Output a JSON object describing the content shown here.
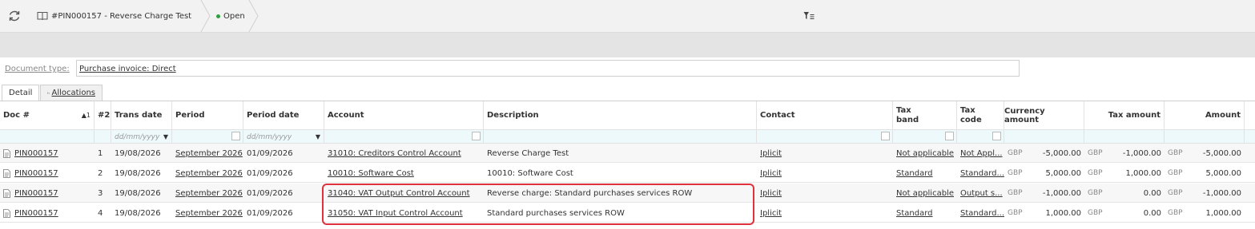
{
  "toolbar": {
    "refresh_icon": "refresh-icon",
    "document_title": "#PIN000157 - Reverse Charge Test",
    "status": "Open",
    "status_color": "#2e9e3e",
    "filter_icon": "filter-icon"
  },
  "document_type": {
    "label": "Document type:",
    "value": "Purchase invoice: Direct"
  },
  "tabs": [
    {
      "label": "Detail"
    },
    {
      "label": "Allocations"
    }
  ],
  "columns": {
    "doc": "Doc #",
    "doc_sort": "▲1",
    "num2": "#2",
    "trans_date": "Trans date",
    "period": "Period",
    "period_date": "Period date",
    "account": "Account",
    "description": "Description",
    "contact": "Contact",
    "tax_band_1": "Tax",
    "tax_band_2": "band",
    "tax_code_1": "Tax",
    "tax_code_2": "code",
    "currency_amount": "Currency amount",
    "tax_amount": "Tax amount",
    "amount": "Amount"
  },
  "filters": {
    "trans_date_placeholder": "dd/mm/yyyy",
    "period_date_placeholder": "dd/mm/yyyy"
  },
  "rows": [
    {
      "doc": "PIN000157",
      "num": "1",
      "trans_date": "19/08/2026",
      "period": "September 2026",
      "period_date": "01/09/2026",
      "account": "31010: Creditors Control Account",
      "description": "Reverse Charge Test",
      "contact": "Iplicit",
      "tax_band": "Not applicable",
      "tax_code": "Not Appl...",
      "cur1": "GBP",
      "currency_amount": "-5,000.00",
      "cur2": "GBP",
      "tax_amount": "-1,000.00",
      "cur3": "GBP",
      "amount": "-5,000.00"
    },
    {
      "doc": "PIN000157",
      "num": "2",
      "trans_date": "19/08/2026",
      "period": "September 2026",
      "period_date": "01/09/2026",
      "account": "10010: Software Cost",
      "description": "10010: Software Cost",
      "contact": "Iplicit",
      "tax_band": "Standard",
      "tax_code": "Standard...",
      "cur1": "GBP",
      "currency_amount": "5,000.00",
      "cur2": "GBP",
      "tax_amount": "1,000.00",
      "cur3": "GBP",
      "amount": "5,000.00"
    },
    {
      "doc": "PIN000157",
      "num": "3",
      "trans_date": "19/08/2026",
      "period": "September 2026",
      "period_date": "01/09/2026",
      "account": "31040: VAT Output Control Account",
      "description": "Reverse charge: Standard purchases services ROW",
      "contact": "Iplicit",
      "tax_band": "Not applicable",
      "tax_code": "Output s...",
      "cur1": "GBP",
      "currency_amount": "-1,000.00",
      "cur2": "GBP",
      "tax_amount": "0.00",
      "cur3": "GBP",
      "amount": "-1,000.00"
    },
    {
      "doc": "PIN000157",
      "num": "4",
      "trans_date": "19/08/2026",
      "period": "September 2026",
      "period_date": "01/09/2026",
      "account": "31050: VAT Input Control Account",
      "description": "Standard purchases services ROW",
      "contact": "Iplicit",
      "tax_band": "Standard",
      "tax_code": "Standard...",
      "cur1": "GBP",
      "currency_amount": "1,000.00",
      "cur2": "GBP",
      "tax_amount": "0.00",
      "cur3": "GBP",
      "amount": "1,000.00"
    }
  ],
  "highlight_color": "#e0323c"
}
